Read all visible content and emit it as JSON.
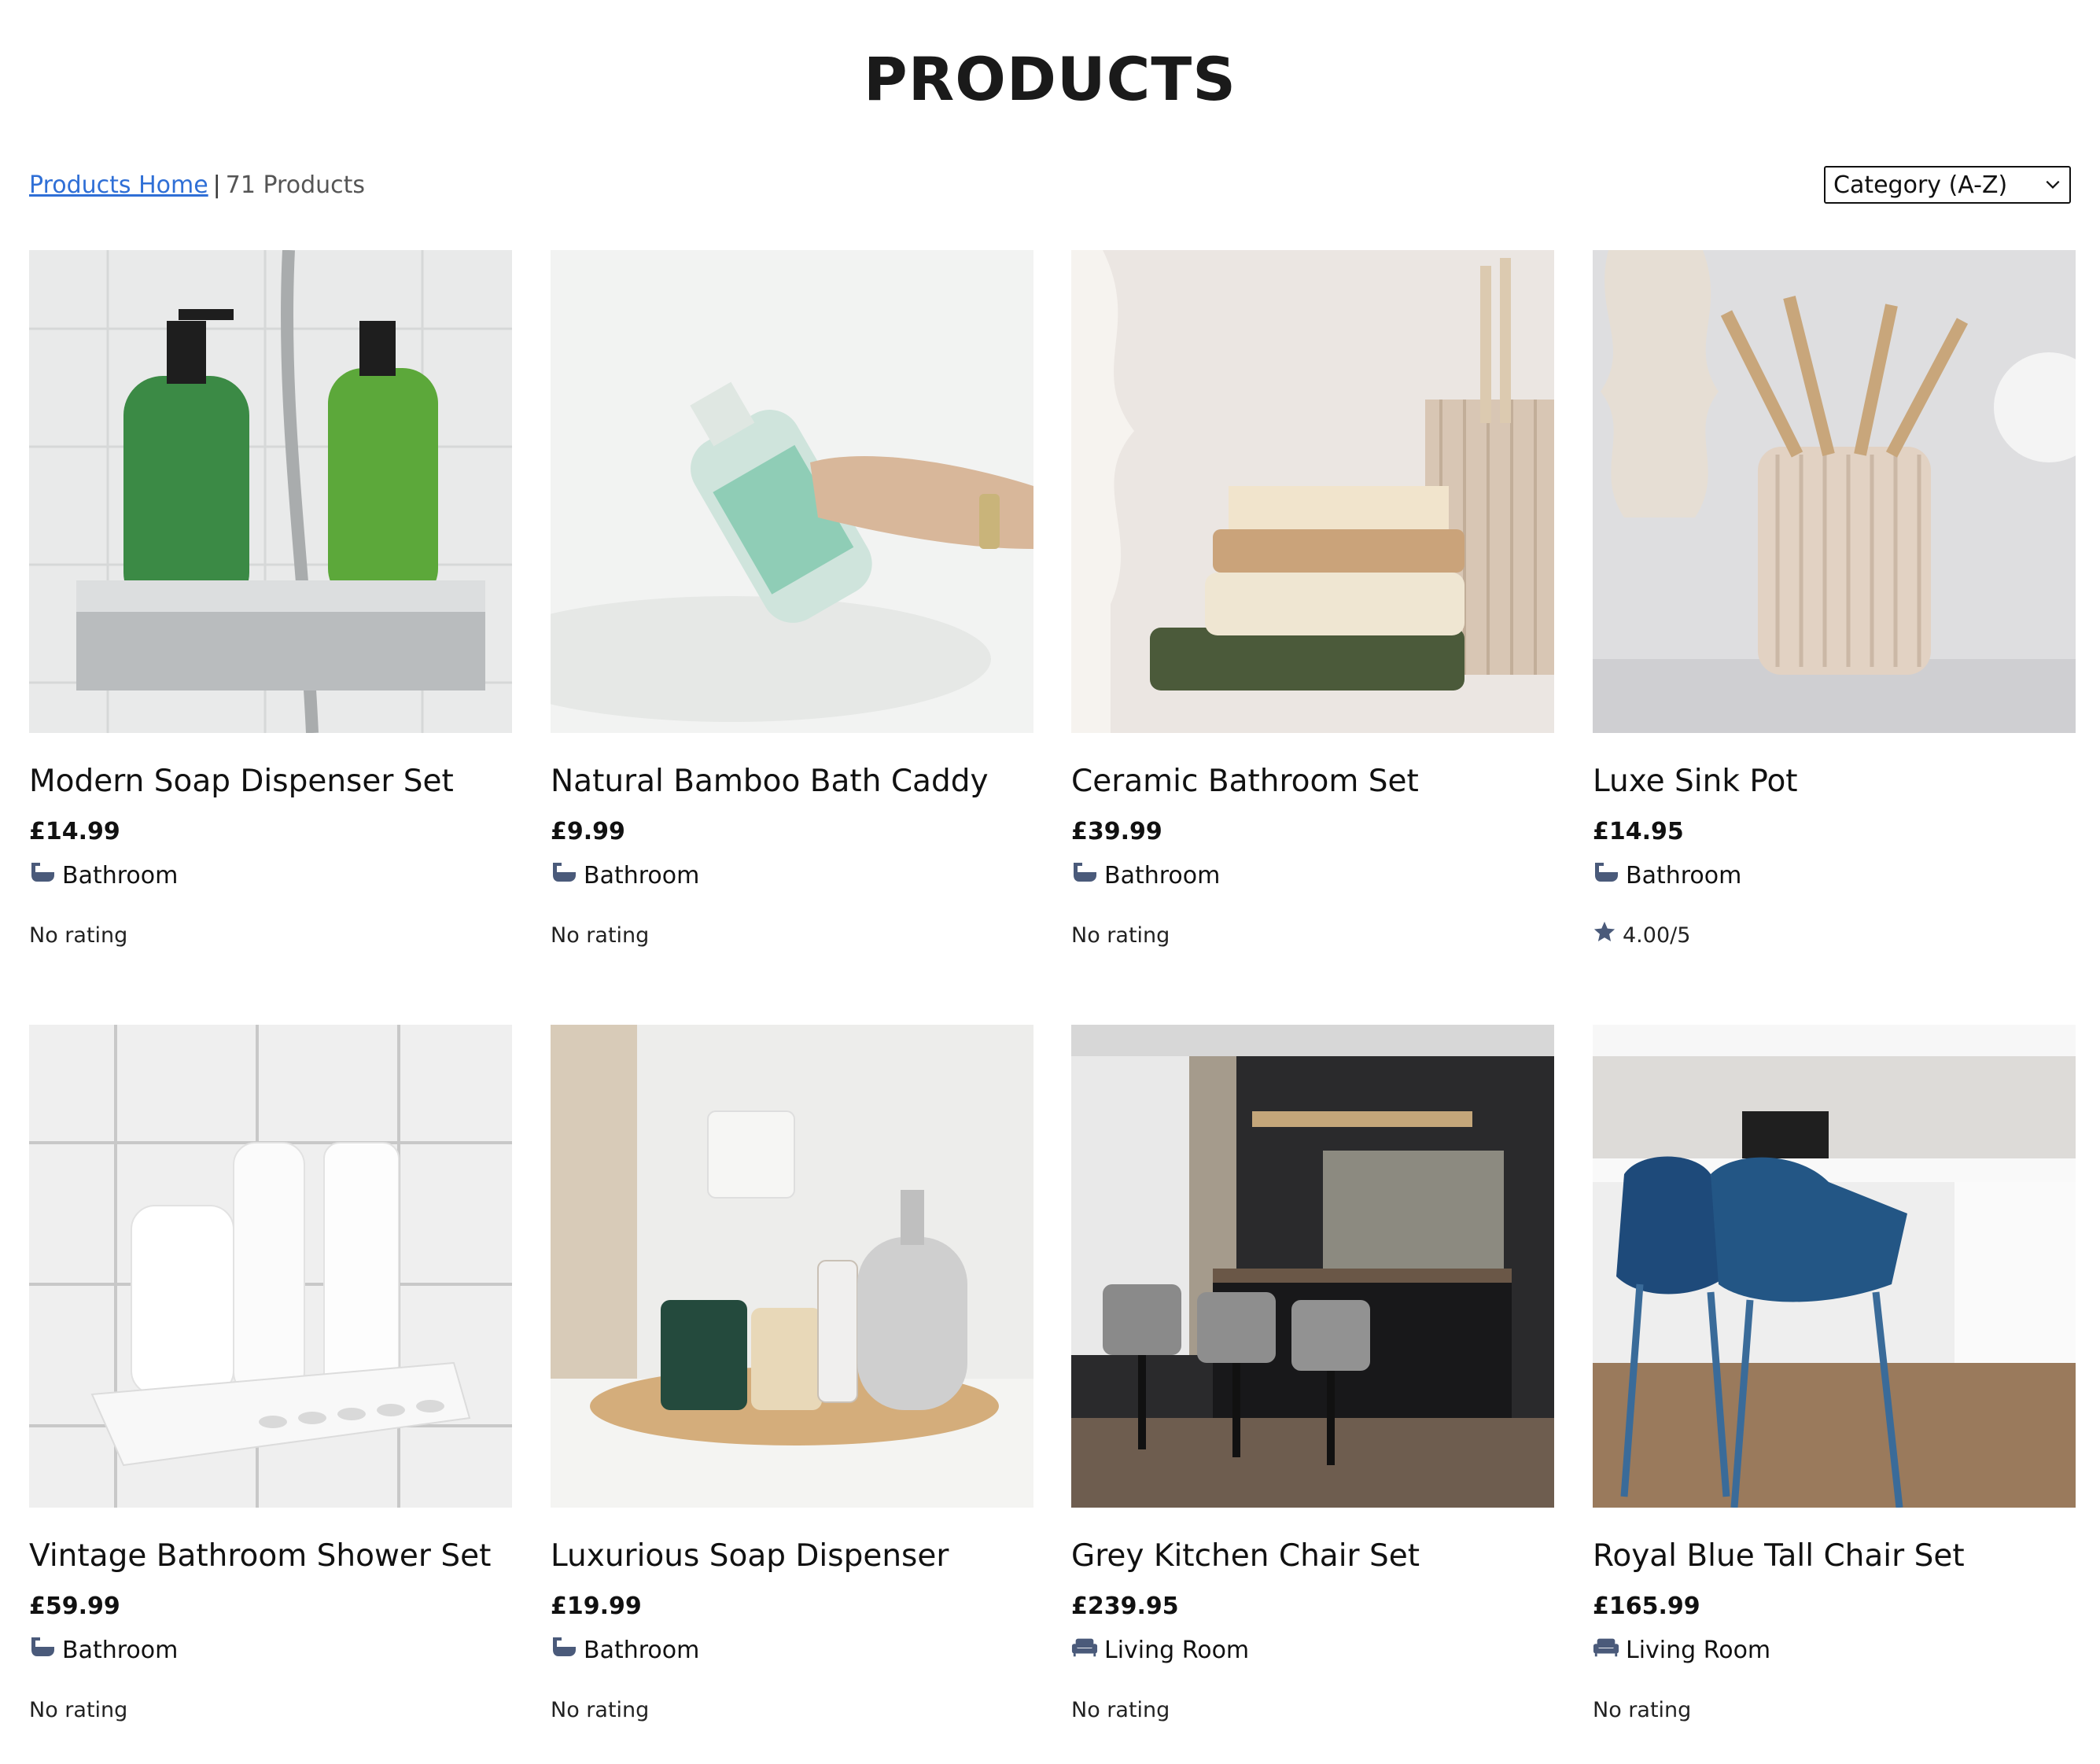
{
  "page": {
    "title": "PRODUCTS"
  },
  "toolbar": {
    "breadcrumb_link": "Products Home",
    "separator": "|",
    "count": "71 Products",
    "sort_selected": "Category (A-Z)"
  },
  "colors": {
    "link": "#2f6fd6",
    "icon": "#4a5a7a",
    "text": "#111111"
  },
  "products": [
    {
      "name": "Modern Soap Dispenser Set",
      "price": "£14.99",
      "category": "Bathroom",
      "category_icon": "bathtub-icon",
      "rating": "No rating"
    },
    {
      "name": "Natural Bamboo Bath Caddy",
      "price": "£9.99",
      "category": "Bathroom",
      "category_icon": "bathtub-icon",
      "rating": "No rating"
    },
    {
      "name": "Ceramic Bathroom Set",
      "price": "£39.99",
      "category": "Bathroom",
      "category_icon": "bathtub-icon",
      "rating": "No rating"
    },
    {
      "name": "Luxe Sink Pot",
      "price": "£14.95",
      "category": "Bathroom",
      "category_icon": "bathtub-icon",
      "rating": "4.00/5",
      "rating_icon": "star-icon"
    },
    {
      "name": "Vintage Bathroom Shower Set",
      "price": "£59.99",
      "category": "Bathroom",
      "category_icon": "bathtub-icon",
      "rating": "No rating"
    },
    {
      "name": "Luxurious Soap Dispenser",
      "price": "£19.99",
      "category": "Bathroom",
      "category_icon": "bathtub-icon",
      "rating": "No rating"
    },
    {
      "name": "Grey Kitchen Chair Set",
      "price": "£239.95",
      "category": "Living Room",
      "category_icon": "sofa-icon",
      "rating": "No rating"
    },
    {
      "name": "Royal Blue Tall Chair Set",
      "price": "£165.99",
      "category": "Living Room",
      "category_icon": "sofa-icon",
      "rating": "No rating"
    }
  ]
}
